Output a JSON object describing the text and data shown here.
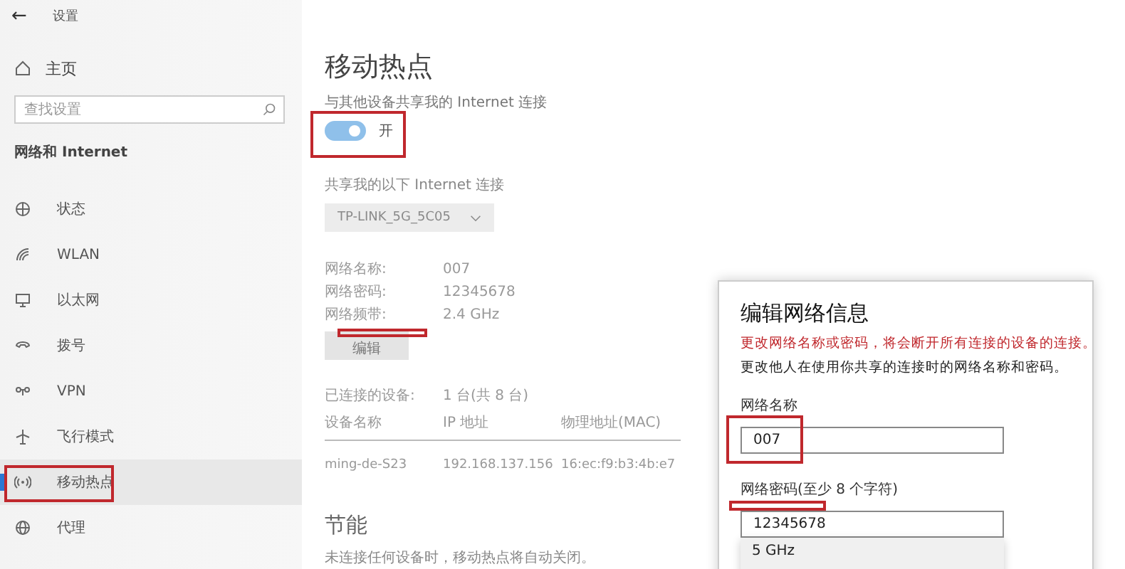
{
  "window": {
    "back": "←",
    "title": "设置"
  },
  "sidebar": {
    "home": "主页",
    "search": {
      "placeholder": "查找设置"
    },
    "section": "网络和 Internet",
    "items": [
      {
        "kind": "status",
        "label": "状态",
        "selected": false
      },
      {
        "kind": "wlan",
        "label": "WLAN",
        "selected": false
      },
      {
        "kind": "ethernet",
        "label": "以太网",
        "selected": false
      },
      {
        "kind": "dialup",
        "label": "拨号",
        "selected": false
      },
      {
        "kind": "vpn",
        "label": "VPN",
        "selected": false
      },
      {
        "kind": "airplane",
        "label": "飞行模式",
        "selected": false
      },
      {
        "kind": "hotspot",
        "label": "移动热点",
        "selected": true
      },
      {
        "kind": "proxy",
        "label": "代理",
        "selected": false
      }
    ]
  },
  "main": {
    "title": "移动热点",
    "share_label": "与其他设备共享我的 Internet 连接",
    "toggle": {
      "on": true,
      "label": "开"
    },
    "source_label": "共享我的以下 Internet 连接",
    "source": {
      "value": "TP-LINK_5G_5C05",
      "disabled": true
    },
    "info": [
      {
        "label": "网络名称:",
        "value": "007"
      },
      {
        "label": "网络密码:",
        "value": "12345678"
      },
      {
        "label": "网络频带:",
        "value": "2.4 GHz"
      }
    ],
    "edit_button": "编辑",
    "connected": {
      "label": "已连接的设备:",
      "value": "1 台(共 8 台)"
    },
    "table": {
      "columns": [
        "设备名称",
        "IP 地址",
        "物理地址(MAC)"
      ],
      "rows": [
        [
          "ming-de-S23",
          "192.168.137.156",
          "16:ec:f9:b3:4b:e7"
        ]
      ]
    },
    "power_title": "节能",
    "power_text": "未连接任何设备时，移动热点将自动关闭。"
  },
  "dialog": {
    "title": "编辑网络信息",
    "warning": "更改网络名称或密码，将会断开所有连接的设备的连接。",
    "description": "更改他人在使用你共享的连接时的网络名称和密码。",
    "name_label": "网络名称",
    "name_value": "007",
    "password_label": "网络密码(至少 8 个字符)",
    "password_value": "12345678",
    "band_menu": [
      "5 GHz"
    ]
  }
}
